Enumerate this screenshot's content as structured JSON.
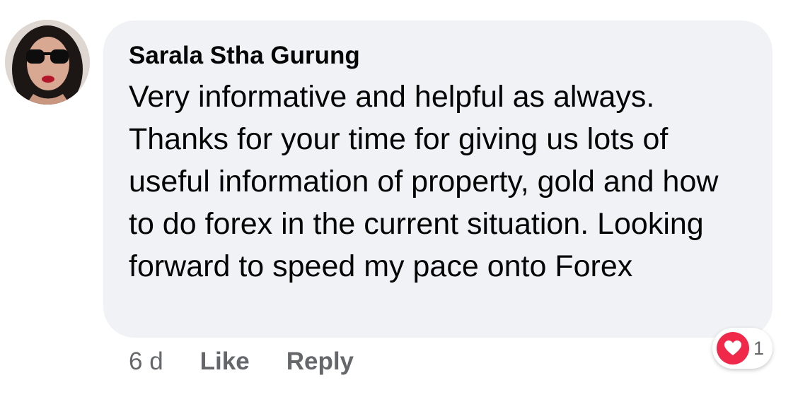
{
  "comment": {
    "author": "Sarala Stha Gurung",
    "text": "Very informative and helpful as always. Thanks for your time for giving us lots of useful information of property, gold and how to do forex in the current situation. Looking forward to speed my pace onto Forex",
    "timestamp": "6 d",
    "like_label": "Like",
    "reply_label": "Reply",
    "reaction": {
      "icon": "heart-icon",
      "count": "1",
      "color": "#f02849"
    }
  },
  "colors": {
    "bubble": "#f0f2f5",
    "text": "#050505",
    "secondary_text": "#65676b"
  }
}
